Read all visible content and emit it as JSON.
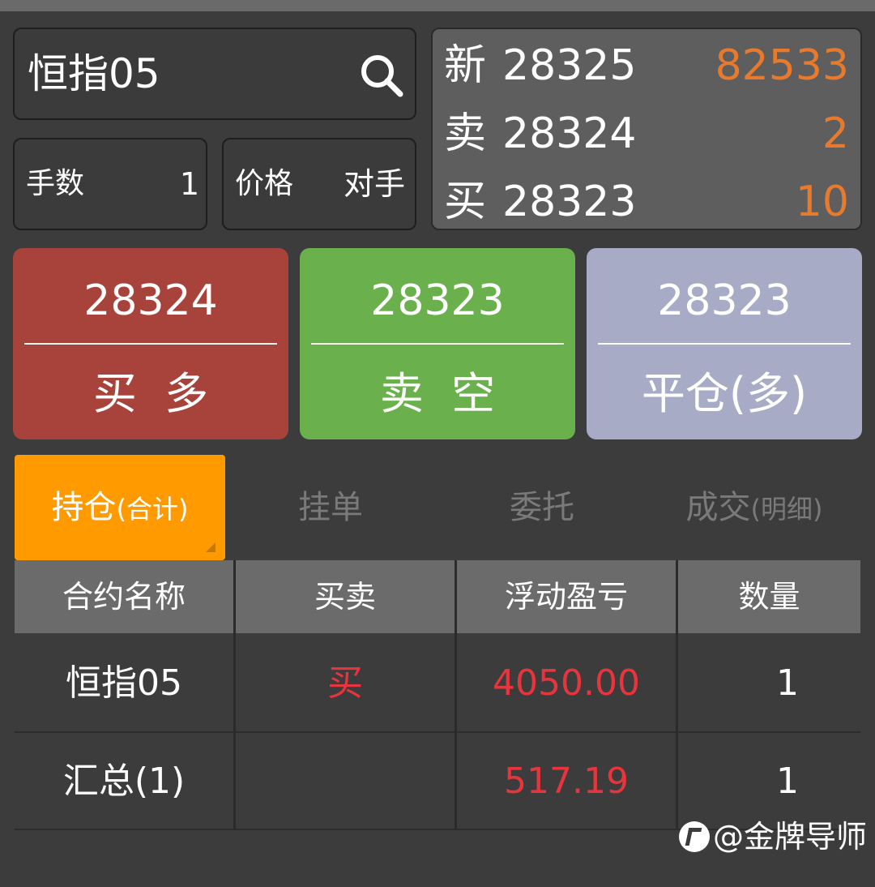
{
  "search": {
    "value": "恒指05"
  },
  "order": {
    "lots_label": "手数",
    "lots_value": "1",
    "price_label": "价格",
    "price_value": "对手"
  },
  "quote": {
    "rows": [
      {
        "label": "新",
        "price": "28325",
        "volume": "82533"
      },
      {
        "label": "卖",
        "price": "28324",
        "volume": "2"
      },
      {
        "label": "买",
        "price": "28323",
        "volume": "10"
      }
    ],
    "volume_color": "#e87a2e"
  },
  "actions": [
    {
      "price": "28324",
      "label": "买  多",
      "color": "#a8433b"
    },
    {
      "price": "28323",
      "label": "卖  空",
      "color": "#6ab04c"
    },
    {
      "price": "28323",
      "label": "平仓(多)",
      "color": "#a8abc6"
    }
  ],
  "tabs": [
    {
      "main": "持仓",
      "sub": "(合计)",
      "active": true
    },
    {
      "main": "挂单",
      "sub": "",
      "active": false
    },
    {
      "main": "委托",
      "sub": "",
      "active": false
    },
    {
      "main": "成交",
      "sub": "(明细)",
      "active": false
    }
  ],
  "table": {
    "headers": [
      "合约名称",
      "买卖",
      "浮动盈亏",
      "数量"
    ],
    "rows": [
      [
        "恒指05",
        "买",
        "4050.00",
        "1"
      ],
      [
        "汇总(1)",
        "",
        "517.19",
        "1"
      ]
    ]
  },
  "watermark": "@金牌导师",
  "colors": {
    "accent": "#ff9a00",
    "loss_profit_red": "#e8353d",
    "background": "#3c3c3c"
  }
}
